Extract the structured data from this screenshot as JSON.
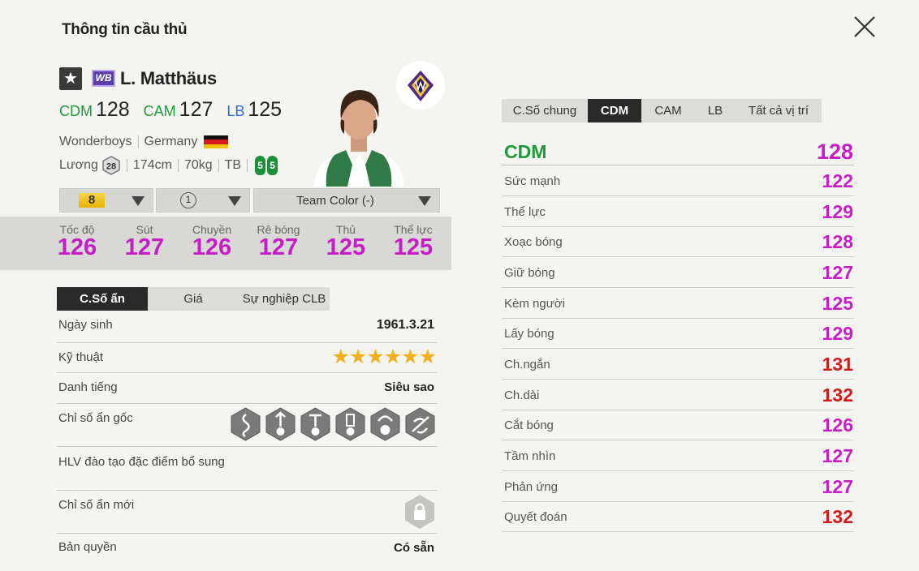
{
  "window": {
    "title": "Thông tin cầu thủ"
  },
  "player": {
    "name": "L. Matthäus",
    "season_badge": "WB",
    "positions": [
      {
        "pos": "CDM",
        "ovr": "128",
        "color": "#1f9a3a"
      },
      {
        "pos": "CAM",
        "ovr": "127",
        "color": "#1f9a3a"
      },
      {
        "pos": "LB",
        "ovr": "125",
        "color": "#2a6ad8"
      }
    ],
    "team": "Wonderboys",
    "nation": "Germany",
    "salary_label": "Lương",
    "salary": "28",
    "height": "174cm",
    "weight": "70kg",
    "body_type": "TB",
    "foot_left": "5",
    "foot_right": "5"
  },
  "selectors": {
    "upgrade_level": "8",
    "trait_level": "1",
    "team_color": "Team Color (-)"
  },
  "main_stats": [
    {
      "label": "Tốc độ",
      "value": "126"
    },
    {
      "label": "Sút",
      "value": "127"
    },
    {
      "label": "Chuyền",
      "value": "126"
    },
    {
      "label": "Rê bóng",
      "value": "127"
    },
    {
      "label": "Thủ",
      "value": "125"
    },
    {
      "label": "Thể lực",
      "value": "125"
    }
  ],
  "left_tabs": [
    "C.Số ẩn",
    "Giá",
    "Sự nghiệp CLB"
  ],
  "details": {
    "birth_label": "Ngày sinh",
    "birth": "1961.3.21",
    "skill_label": "Kỹ thuật",
    "skill_stars": 6,
    "fame_label": "Danh tiếng",
    "fame": "Siêu sao",
    "traits_label": "Chỉ số ẩn gốc",
    "traits": [
      "dribbler-icon",
      "long-shot-icon",
      "power-header-icon",
      "finesse-icon",
      "playmaker-icon",
      "team-player-icon"
    ],
    "coach_label": "HLV đào tạo đặc điểm bổ sung",
    "new_traits_label": "Chỉ số ẩn mới",
    "license_label": "Bản quyền",
    "license": "Có sẵn"
  },
  "right_tabs": [
    "C.Số chung",
    "CDM",
    "CAM",
    "LB",
    "Tất cả vị trí"
  ],
  "position_stats": {
    "header": {
      "label": "CDM",
      "value": "128"
    },
    "rows": [
      {
        "label": "Sức mạnh",
        "value": "122",
        "color": "#c51ec6"
      },
      {
        "label": "Thể lực",
        "value": "129",
        "color": "#c51ec6"
      },
      {
        "label": "Xoạc bóng",
        "value": "128",
        "color": "#c51ec6"
      },
      {
        "label": "Giữ bóng",
        "value": "127",
        "color": "#c51ec6"
      },
      {
        "label": "Kèm người",
        "value": "125",
        "color": "#c51ec6"
      },
      {
        "label": "Lấy bóng",
        "value": "129",
        "color": "#c51ec6"
      },
      {
        "label": "Ch.ngắn",
        "value": "131",
        "color": "#cf1b1b"
      },
      {
        "label": "Ch.dài",
        "value": "132",
        "color": "#cf1b1b"
      },
      {
        "label": "Cắt bóng",
        "value": "126",
        "color": "#c51ec6"
      },
      {
        "label": "Tầm nhìn",
        "value": "127",
        "color": "#c51ec6"
      },
      {
        "label": "Phản ứng",
        "value": "127",
        "color": "#c51ec6"
      },
      {
        "label": "Quyết đoán",
        "value": "132",
        "color": "#cf1b1b"
      }
    ]
  }
}
